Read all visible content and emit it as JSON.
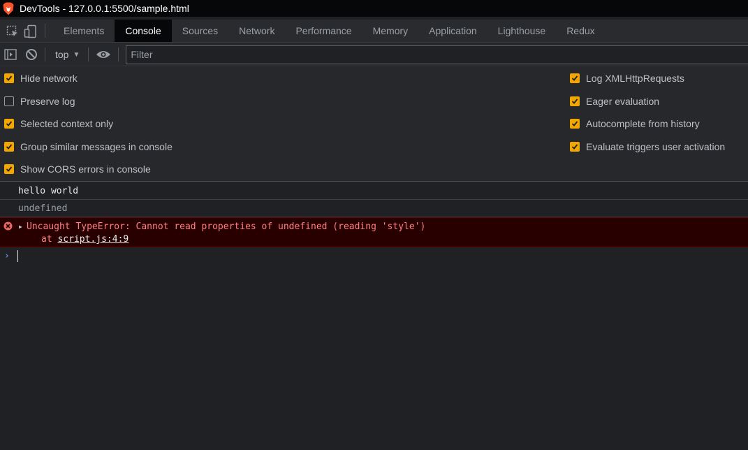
{
  "window": {
    "title": "DevTools - 127.0.0.1:5500/sample.html"
  },
  "tabs": [
    {
      "label": "Elements"
    },
    {
      "label": "Console",
      "active": true
    },
    {
      "label": "Sources"
    },
    {
      "label": "Network"
    },
    {
      "label": "Performance"
    },
    {
      "label": "Memory"
    },
    {
      "label": "Application"
    },
    {
      "label": "Lighthouse"
    },
    {
      "label": "Redux"
    }
  ],
  "console_toolbar": {
    "context": "top",
    "filter_placeholder": "Filter"
  },
  "settings": {
    "left": [
      {
        "label": "Hide network",
        "checked": true
      },
      {
        "label": "Preserve log",
        "checked": false
      },
      {
        "label": "Selected context only",
        "checked": true
      },
      {
        "label": "Group similar messages in console",
        "checked": true
      },
      {
        "label": "Show CORS errors in console",
        "checked": true
      }
    ],
    "right": [
      {
        "label": "Log XMLHttpRequests",
        "checked": true
      },
      {
        "label": "Eager evaluation",
        "checked": true
      },
      {
        "label": "Autocomplete from history",
        "checked": true
      },
      {
        "label": "Evaluate triggers user activation",
        "checked": true
      }
    ]
  },
  "console": {
    "messages": [
      {
        "text": "hello world"
      },
      {
        "text": "undefined"
      }
    ],
    "error": {
      "message": "Uncaught TypeError: Cannot read properties of undefined (reading 'style')",
      "at_prefix": "at",
      "link": "script.js:4:9"
    },
    "prompt_symbol": "›"
  },
  "colors": {
    "accent_checkbox": "#f2a600",
    "error_text": "#ff8080",
    "error_bg": "#290000",
    "prompt": "#6ea2ff"
  }
}
